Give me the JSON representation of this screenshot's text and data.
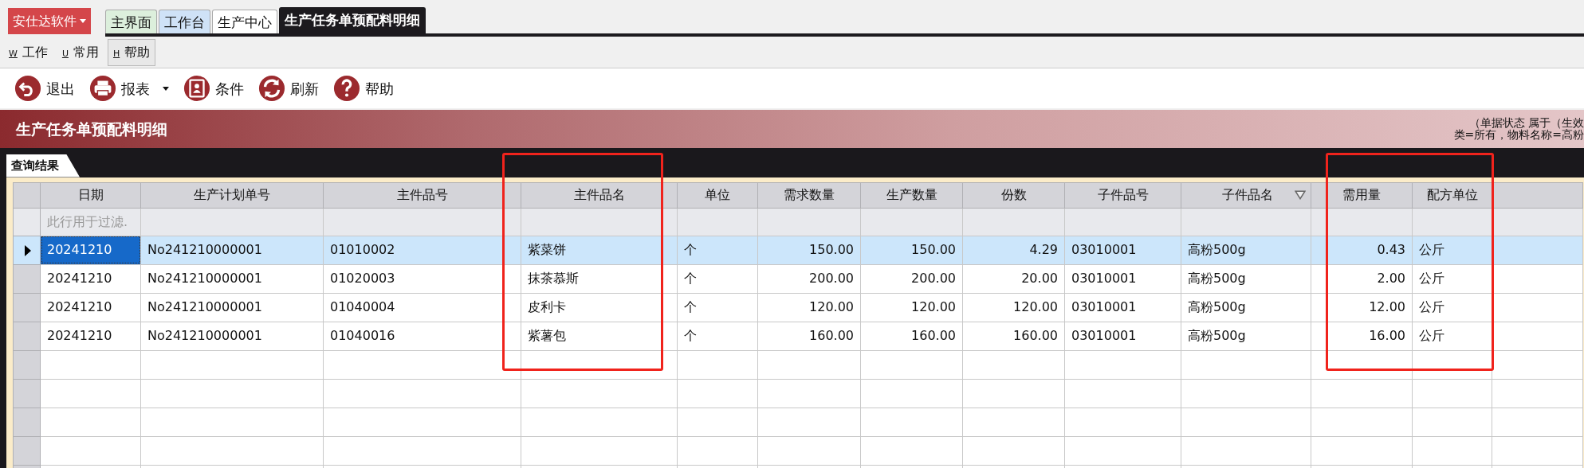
{
  "app_button": {
    "label": "安仕达软件"
  },
  "tabs": [
    {
      "label": "主界面",
      "selected": false,
      "color": "#dcefdc"
    },
    {
      "label": "工作台",
      "selected": false,
      "color": "#cfe2f7"
    },
    {
      "label": "生产中心",
      "selected": false,
      "color": "#ffffff"
    },
    {
      "label": "生产任务单预配料明细",
      "selected": true,
      "color": "#1c1a1e"
    }
  ],
  "menu": [
    {
      "key": "W",
      "label": "工作",
      "hovered": false
    },
    {
      "key": "U",
      "label": "常用",
      "hovered": false
    },
    {
      "key": "H",
      "label": "帮助",
      "hovered": true
    }
  ],
  "toolbar": [
    {
      "kind": "exit",
      "label": "退出",
      "dropdown": false
    },
    {
      "kind": "print",
      "label": "报表",
      "dropdown": true
    },
    {
      "kind": "filter",
      "label": "条件",
      "dropdown": false
    },
    {
      "kind": "refresh",
      "label": "刷新",
      "dropdown": false
    },
    {
      "kind": "help",
      "label": "帮助",
      "dropdown": false
    }
  ],
  "banner": {
    "title": "生产任务单预配料明细",
    "criteria_lines": [
      "（单据状态 属于（生效",
      "类=所有，物料名称=高粉"
    ]
  },
  "result_tab": {
    "label": "查询结果"
  },
  "table": {
    "columns": [
      {
        "label": "日期",
        "kind": "text",
        "filter_icon": false
      },
      {
        "label": "生产计划单号",
        "kind": "text",
        "filter_icon": false
      },
      {
        "label": "主件品号",
        "kind": "text",
        "filter_icon": false
      },
      {
        "label": "主件品名",
        "kind": "text",
        "filter_icon": false,
        "framed": true
      },
      {
        "label": "单位",
        "kind": "text",
        "filter_icon": false
      },
      {
        "label": "需求数量",
        "kind": "number",
        "filter_icon": false
      },
      {
        "label": "生产数量",
        "kind": "number",
        "filter_icon": false
      },
      {
        "label": "份数",
        "kind": "number",
        "filter_icon": false
      },
      {
        "label": "子件品号",
        "kind": "text",
        "filter_icon": false
      },
      {
        "label": "子件品名",
        "kind": "text",
        "filter_icon": true
      },
      {
        "label": "需用量",
        "kind": "number",
        "filter_icon": false,
        "framed": true
      },
      {
        "label": "配方单位",
        "kind": "text",
        "filter_icon": false,
        "framed": true
      }
    ],
    "filter_placeholder": "此行用于过滤.",
    "rows": [
      {
        "selected": true,
        "cells": [
          "20241210",
          "No241210000001",
          "01010002",
          "紫菜饼",
          "个",
          "150.00",
          "150.00",
          "4.29",
          "03010001",
          "高粉500g",
          "0.43",
          "公斤"
        ]
      },
      {
        "selected": false,
        "cells": [
          "20241210",
          "No241210000001",
          "01020003",
          "抹茶慕斯",
          "个",
          "200.00",
          "200.00",
          "20.00",
          "03010001",
          "高粉500g",
          "2.00",
          "公斤"
        ]
      },
      {
        "selected": false,
        "cells": [
          "20241210",
          "No241210000001",
          "01040004",
          "皮利卡",
          "个",
          "120.00",
          "120.00",
          "120.00",
          "03010001",
          "高粉500g",
          "12.00",
          "公斤"
        ]
      },
      {
        "selected": false,
        "cells": [
          "20241210",
          "No241210000001",
          "01040016",
          "紫薯包",
          "个",
          "160.00",
          "160.00",
          "160.00",
          "03010001",
          "高粉500g",
          "16.00",
          "公斤"
        ]
      }
    ]
  }
}
